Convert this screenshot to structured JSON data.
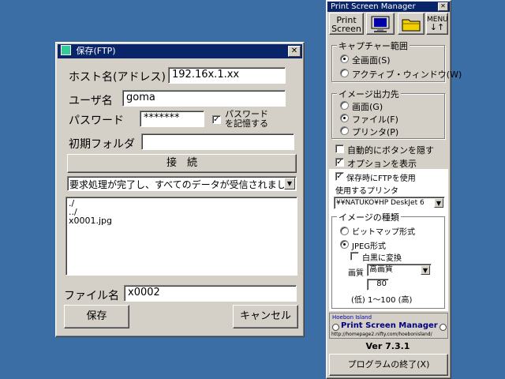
{
  "ftp_dialog": {
    "title": "保存(FTP)",
    "close_label": "✕",
    "host_label": "ホスト名(アドレス)",
    "host_value": "192.16x.1.xx",
    "user_label": "ユーザ名",
    "user_value": "goma",
    "password_label": "パスワード",
    "password_value": "*******",
    "remember_line1": "パスワード",
    "remember_line2": "を記憶する",
    "remember_check": "✓",
    "folder_label": "初期フォルダ",
    "folder_value": "",
    "connect_label": "接　続",
    "status_text": "要求処理が完了し、すべてのデータが受信されました。",
    "files": [
      "./",
      "../",
      "x0001.jpg"
    ],
    "filename_label": "ファイル名",
    "filename_value": "x0002",
    "save_label": "保存",
    "cancel_label": "キャンセル"
  },
  "psm": {
    "title": "Print Screen Manager",
    "close_label": "✕",
    "print_screen_line1": "Print",
    "print_screen_line2": "Screen",
    "menu_line1": "MENU",
    "menu_line2": "↓↑",
    "capture_group": "キャプチャー範囲",
    "capture_full": "全画面(S)",
    "capture_active": "アクティブ・ウィンドウ(W)",
    "output_group": "イメージ出力先",
    "output_screen": "画面(G)",
    "output_file": "ファイル(F)",
    "output_printer": "プリンタ(P)",
    "auto_hide": "自動的にボタンを隠す",
    "show_options": "オプションを表示",
    "ftp_on_save": "保存時にFTPを使用",
    "printer_label": "使用するプリンタ",
    "printer_value": "¥¥NATUKO¥HP DeskJet 6",
    "image_type_group": "イメージの種類",
    "bitmap": "ビットマップ形式",
    "jpeg": "JPEG形式",
    "monochrome": "白黒に変換",
    "quality_label": "画質",
    "quality_value": "高画質",
    "quality_number": "80",
    "quality_range": "(低) 1～100 (高)",
    "logo_small": "Hoebon Island",
    "logo_main": "Print Screen Manager",
    "logo_url": "http://homepage2.nifty.com/hoebonisland/",
    "version": "Ver 7.3.1",
    "exit_label": "プログラムの終了(X)",
    "check_mark": "✓"
  }
}
